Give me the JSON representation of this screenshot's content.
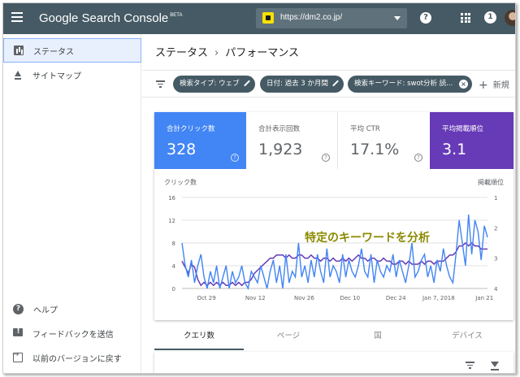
{
  "topbar": {
    "app_title": "Google Search Console",
    "app_badge": "BETA",
    "property_url": "https://dm2.co.jp/",
    "notification_count": "1"
  },
  "sidebar": {
    "items": [
      {
        "label": "ステータス",
        "icon": "bar-chart-icon"
      },
      {
        "label": "サイトマップ",
        "icon": "upload-icon"
      }
    ],
    "bottom_items": [
      {
        "label": "ヘルプ",
        "icon": "help-icon"
      },
      {
        "label": "フィードバックを送信",
        "icon": "feedback-icon"
      },
      {
        "label": "以前のバージョンに戻す",
        "icon": "exit-icon"
      }
    ]
  },
  "breadcrumb": {
    "parent": "ステータス",
    "separator": "›",
    "current": "パフォーマンス"
  },
  "filters": {
    "chips": [
      {
        "label": "検索タイプ: ウェブ"
      },
      {
        "label": "日付: 過去 3 か月間"
      },
      {
        "label": "検索キーワード: swot分析 読..."
      }
    ],
    "new_label": "新規"
  },
  "metrics": [
    {
      "label": "合計クリック数",
      "value": "328"
    },
    {
      "label": "合計表示回数",
      "value": "1,923"
    },
    {
      "label": "平均 CTR",
      "value": "17.1%"
    },
    {
      "label": "平均掲載順位",
      "value": "3.1"
    }
  ],
  "colors": {
    "clicks": "#4285f4",
    "position": "#673ab7",
    "topbar": "#455a64"
  },
  "chart_data": {
    "type": "line",
    "ylabel": "クリック数",
    "y2label": "掲載順位",
    "ylim": [
      0,
      16
    ],
    "yticks": [
      "16",
      "12",
      "8",
      "4",
      "0"
    ],
    "y2lim": [
      1,
      4
    ],
    "y2ticks": [
      "1",
      "2",
      "3",
      "4"
    ],
    "xticks": [
      "Oct 29",
      "Nov 12",
      "Nov 26",
      "Dec 10",
      "Dec 24",
      "Jan 7, 2018",
      "Jan 21"
    ],
    "annotation": "特定のキーワードを分析",
    "series": [
      {
        "name": "クリック数",
        "values": [
          8,
          4,
          2,
          5,
          1,
          4,
          6,
          2,
          0,
          3,
          1,
          4,
          0,
          2,
          4,
          0,
          3,
          1,
          2,
          4,
          1,
          0,
          3,
          2,
          1,
          4,
          2,
          0,
          3,
          5,
          1,
          4,
          0,
          6,
          1,
          3,
          2,
          8,
          2,
          4,
          1,
          5,
          2,
          6,
          3,
          1,
          7,
          2,
          4,
          3,
          1,
          6,
          2,
          5,
          3,
          2,
          4,
          7,
          3,
          2,
          6,
          1,
          5,
          3,
          2,
          4,
          3,
          6,
          2,
          5,
          3,
          1,
          4,
          8,
          2,
          3,
          5,
          6,
          2,
          4,
          1,
          5,
          3,
          7,
          4,
          2,
          1,
          6,
          12,
          8,
          4,
          13,
          6,
          12,
          10,
          5,
          11,
          9
        ]
      },
      {
        "name": "掲載順位",
        "values": [
          3.1,
          3.3,
          3.5,
          3.2,
          3.3,
          3.7,
          3.9,
          3.8,
          3.9,
          3.8,
          3.9,
          3.8,
          3.9,
          3.8,
          3.9,
          3.9,
          3.8,
          3.9,
          3.8,
          3.9,
          3.8,
          3.8,
          3.7,
          3.5,
          3.4,
          3.3,
          3.2,
          3.1,
          3.0,
          3.0,
          2.9,
          2.9,
          2.9,
          3.0,
          2.9,
          3.0,
          3.0,
          2.9,
          2.9,
          3.0,
          3.0,
          2.9,
          3.0,
          3.0,
          3.1,
          3.0,
          3.0,
          3.1,
          3.0,
          3.1,
          3.1,
          3.0,
          3.1,
          3.0,
          3.1,
          3.0,
          2.9,
          3.0,
          3.0,
          3.1,
          3.0,
          3.0,
          3.1,
          3.1,
          3.0,
          3.1,
          3.1,
          3.2,
          3.2,
          3.1,
          3.1,
          3.2,
          3.1,
          3.2,
          3.2,
          3.2,
          3.1,
          3.2,
          3.1,
          3.1,
          3.2,
          3.1,
          3.1,
          3.1,
          3.0,
          2.9,
          2.9,
          2.8,
          2.6,
          2.6,
          2.5,
          2.6,
          2.5,
          2.6,
          2.6,
          2.7,
          2.7,
          2.7
        ]
      }
    ]
  },
  "tabs": [
    {
      "label": "クエリ数"
    },
    {
      "label": "ページ"
    },
    {
      "label": "国"
    },
    {
      "label": "デバイス"
    }
  ]
}
